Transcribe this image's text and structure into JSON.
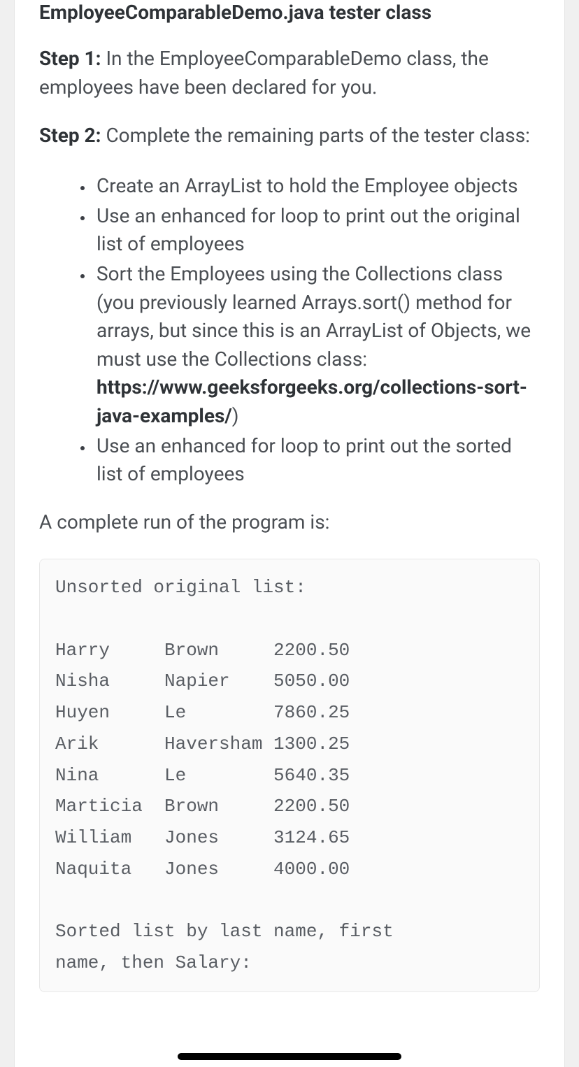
{
  "heading": "EmployeeComparableDemo.java tester class",
  "step1": {
    "label": "Step 1:",
    "text": " In the EmployeeComparableDemo class, the employees have been declared for you."
  },
  "step2": {
    "label": "Step 2:",
    "text": " Complete the remaining parts of the tester class:"
  },
  "bullets": {
    "b1": "Create an ArrayList to hold the Employee objects",
    "b2": "Use an enhanced for loop to print out the original list of employees",
    "b3_prefix": "Sort the Employees using the Collections class (you previously learned Arrays.sort() method for arrays, but since this is an ArrayList of Objects, we must use the Collections class: ",
    "b3_link": "https://www.geeksforgeeks.org/collections-sort-java-examples/",
    "b3_suffix": ")",
    "b4": "Use an enhanced for loop to print out the sorted list of employees"
  },
  "run_intro": "A complete run of the program is:",
  "code": "Unsorted original list:\n\nHarry     Brown     2200.50\nNisha     Napier    5050.00\nHuyen     Le        7860.25\nArik      Haversham 1300.25\nNina      Le        5640.35\nMarticia  Brown     2200.50\nWilliam   Jones     3124.65\nNaquita   Jones     4000.00\n\nSorted list by last name, first \nname, then Salary:",
  "chart_data": {
    "type": "table",
    "title": "Unsorted original list",
    "columns": [
      "first_name",
      "last_name",
      "salary"
    ],
    "rows": [
      [
        "Harry",
        "Brown",
        2200.5
      ],
      [
        "Nisha",
        "Napier",
        5050.0
      ],
      [
        "Huyen",
        "Le",
        7860.25
      ],
      [
        "Arik",
        "Haversham",
        1300.25
      ],
      [
        "Nina",
        "Le",
        5640.35
      ],
      [
        "Marticia",
        "Brown",
        2200.5
      ],
      [
        "William",
        "Jones",
        3124.65
      ],
      [
        "Naquita",
        "Jones",
        4000.0
      ]
    ]
  }
}
